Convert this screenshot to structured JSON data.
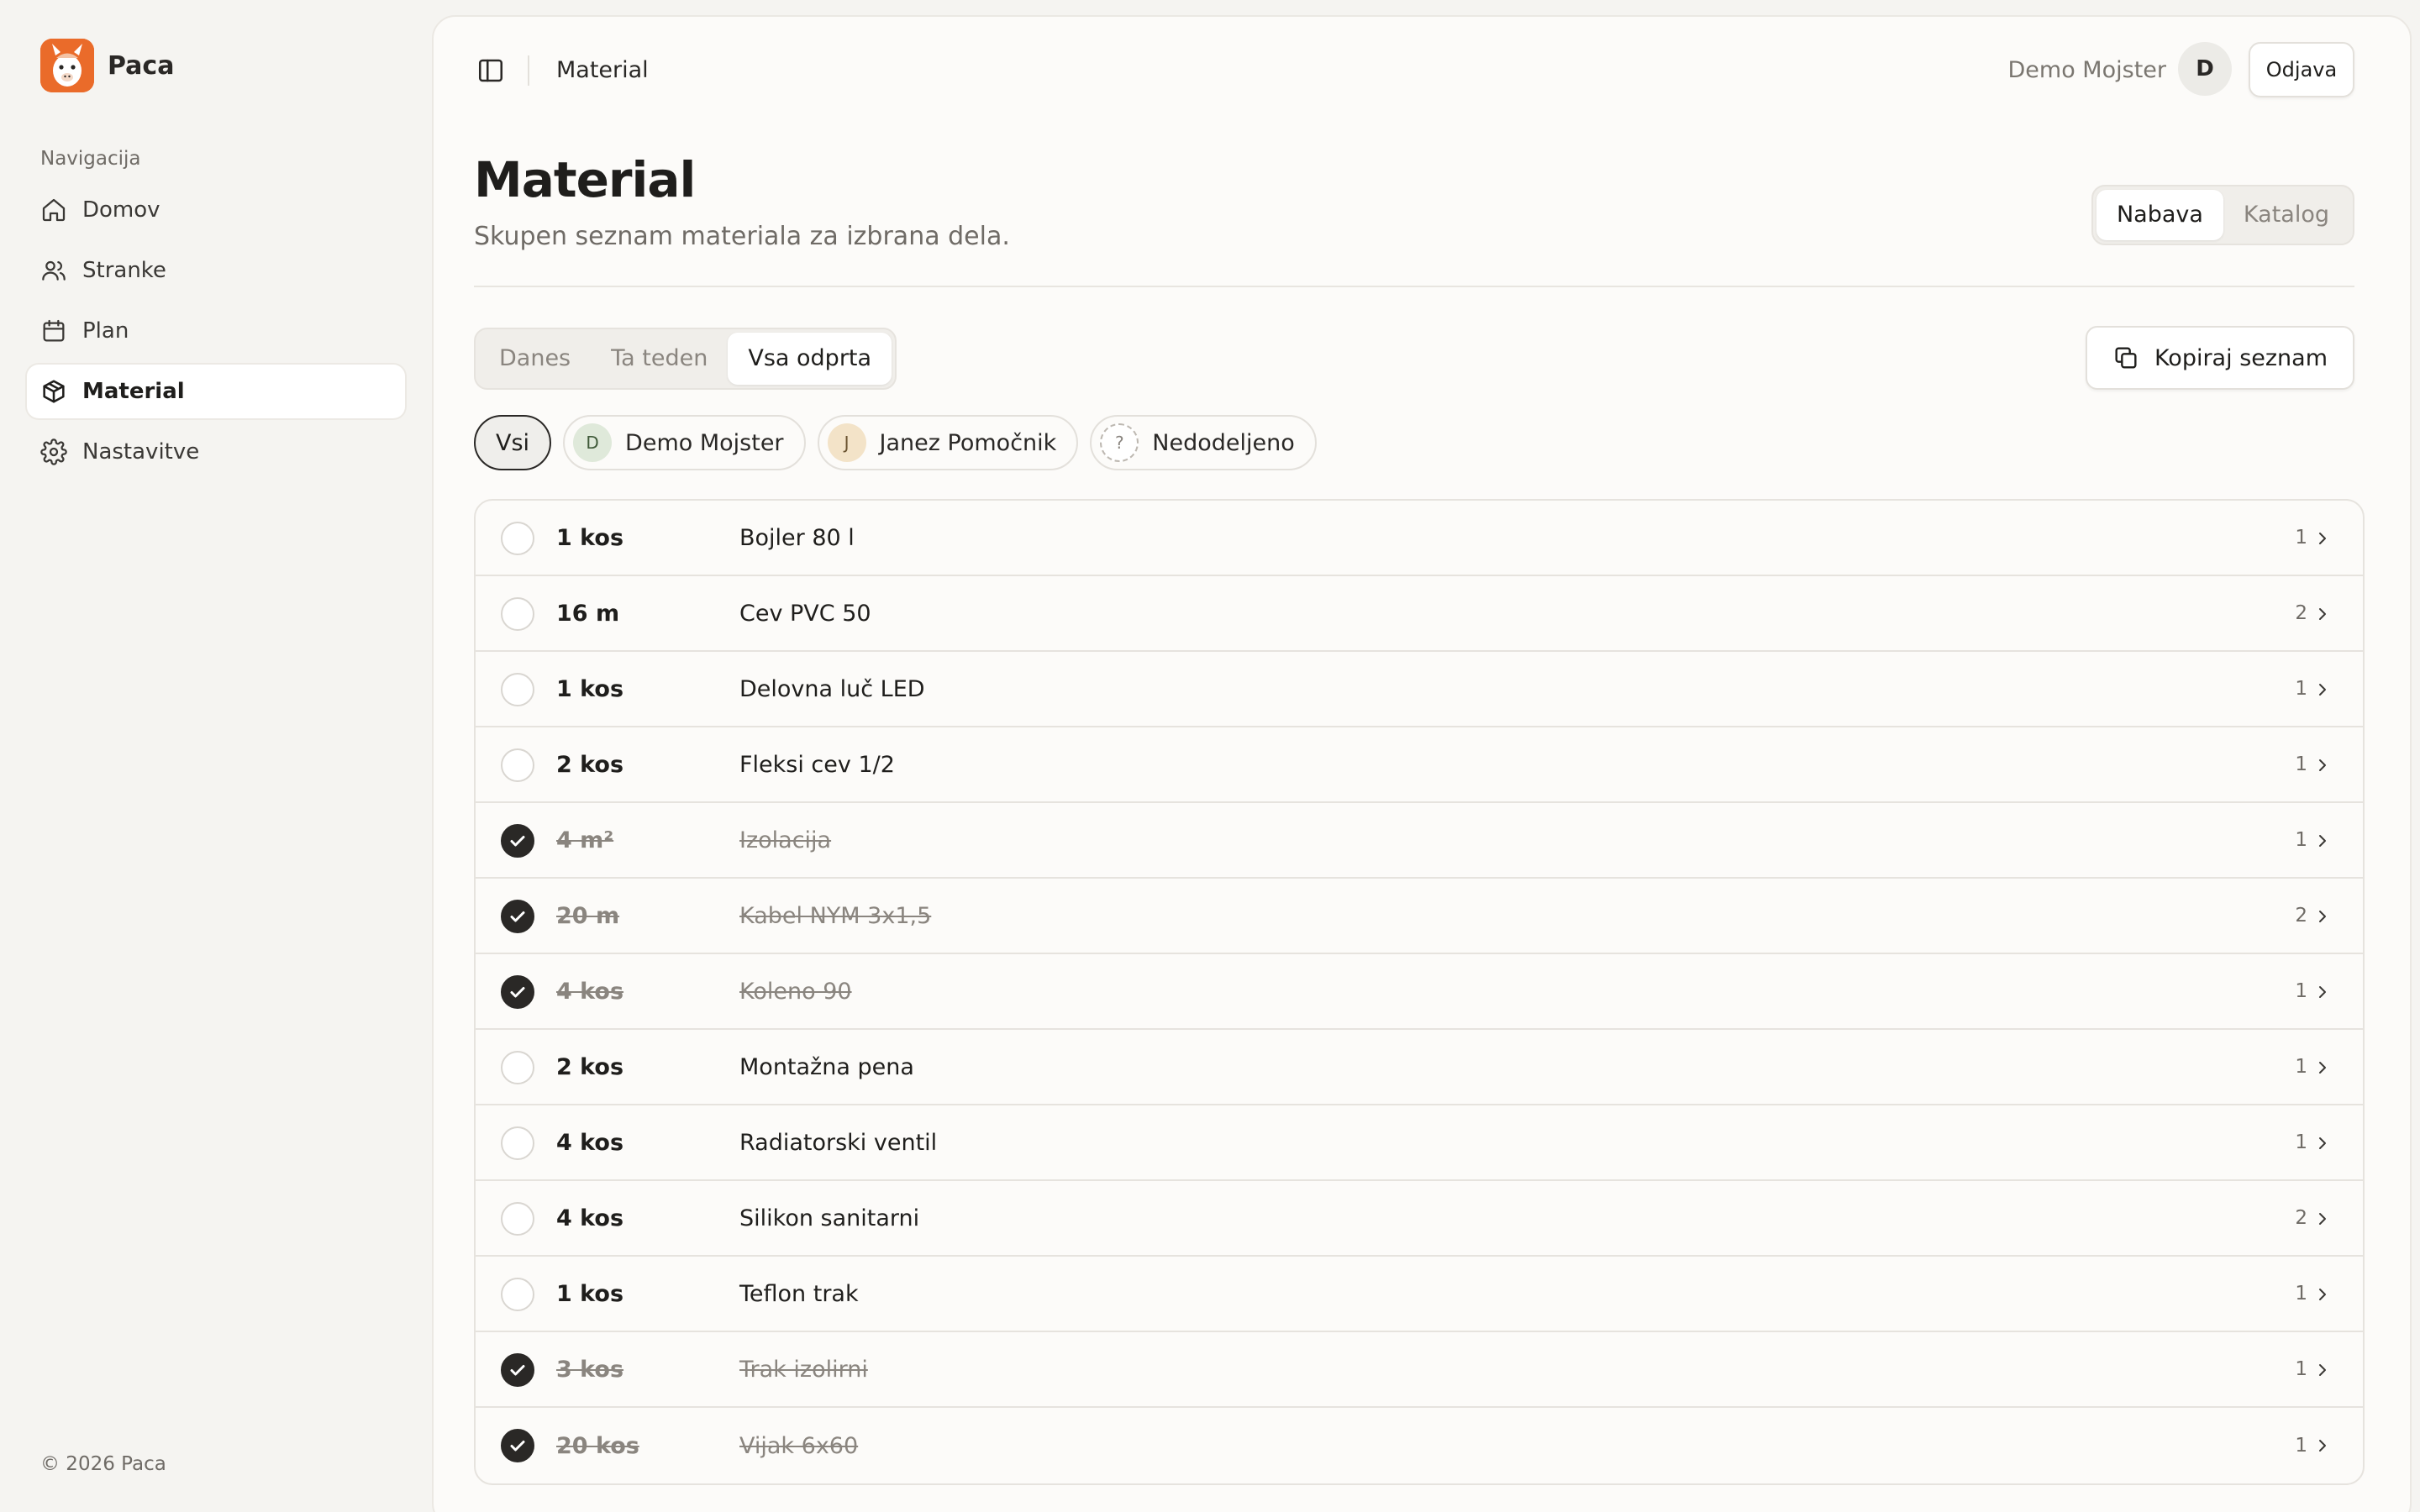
{
  "app": {
    "name": "Paca",
    "copyright": "© 2026 Paca"
  },
  "sidebar": {
    "heading": "Navigacija",
    "items": [
      {
        "label": "Domov",
        "icon": "home-icon",
        "active": false
      },
      {
        "label": "Stranke",
        "icon": "users-icon",
        "active": false
      },
      {
        "label": "Plan",
        "icon": "calendar-icon",
        "active": false
      },
      {
        "label": "Material",
        "icon": "package-icon",
        "active": true
      },
      {
        "label": "Nastavitve",
        "icon": "gear-icon",
        "active": false
      }
    ]
  },
  "topbar": {
    "title": "Material",
    "user_name": "Demo Mojster",
    "avatar_initial": "D",
    "logout_label": "Odjava"
  },
  "page": {
    "title": "Material",
    "subtitle": "Skupen seznam materiala za izbrana dela.",
    "view_tabs": [
      {
        "label": "Nabava",
        "active": true
      },
      {
        "label": "Katalog",
        "active": false
      }
    ],
    "filter_tabs": [
      {
        "label": "Danes",
        "active": false
      },
      {
        "label": "Ta teden",
        "active": false
      },
      {
        "label": "Vsa odprta",
        "active": true
      }
    ],
    "copy_button": "Kopiraj seznam",
    "assignee_chips": [
      {
        "label": "Vsi",
        "initial": ""
      },
      {
        "label": "Demo Mojster",
        "initial": "D"
      },
      {
        "label": "Janez Pomočnik",
        "initial": "J"
      },
      {
        "label": "Nedodeljeno",
        "initial": "?"
      }
    ]
  },
  "materials": [
    {
      "qty": "1 kos",
      "name": "Bojler 80 l",
      "count": "1",
      "done": false
    },
    {
      "qty": "16 m",
      "name": "Cev PVC 50",
      "count": "2",
      "done": false
    },
    {
      "qty": "1 kos",
      "name": "Delovna luč LED",
      "count": "1",
      "done": false
    },
    {
      "qty": "2 kos",
      "name": "Fleksi cev 1/2",
      "count": "1",
      "done": false
    },
    {
      "qty": "4 m²",
      "name": "Izolacija",
      "count": "1",
      "done": true
    },
    {
      "qty": "20 m",
      "name": "Kabel NYM 3x1,5",
      "count": "2",
      "done": true
    },
    {
      "qty": "4 kos",
      "name": "Koleno 90",
      "count": "1",
      "done": true
    },
    {
      "qty": "2 kos",
      "name": "Montažna pena",
      "count": "1",
      "done": false
    },
    {
      "qty": "4 kos",
      "name": "Radiatorski ventil",
      "count": "1",
      "done": false
    },
    {
      "qty": "4 kos",
      "name": "Silikon sanitarni",
      "count": "2",
      "done": false
    },
    {
      "qty": "1 kos",
      "name": "Teflon trak",
      "count": "1",
      "done": false
    },
    {
      "qty": "3 kos",
      "name": "Trak izolirni",
      "count": "1",
      "done": true
    },
    {
      "qty": "20 kos",
      "name": "Vijak 6x60",
      "count": "1",
      "done": true
    }
  ]
}
